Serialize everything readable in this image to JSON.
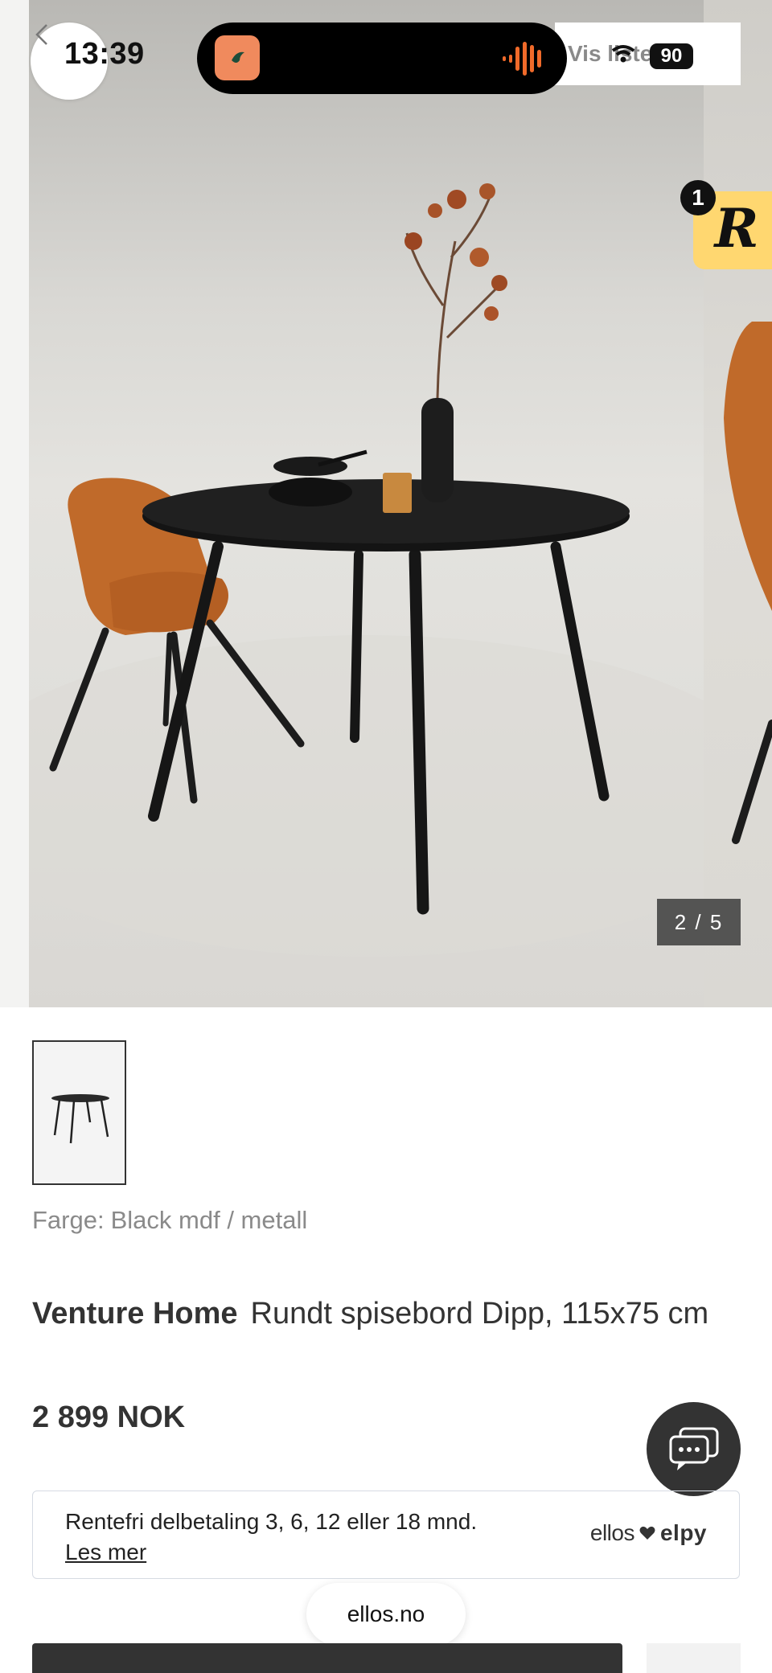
{
  "status_bar": {
    "time": "13:39",
    "battery": "90"
  },
  "gallery": {
    "counter": "2 / 5",
    "vis_liste_label": "Vis liste",
    "badge_letter": "R",
    "badge_count": "1"
  },
  "product": {
    "color_label": "Farge:",
    "color_value": "Black mdf / metall",
    "brand": "Venture Home",
    "name": "Rundt spisebord Dipp, 115x75 cm",
    "price": "2 899 NOK"
  },
  "installment": {
    "text": "Rentefri delbetaling 3, 6, 12 eller 18 mnd.",
    "link": "Les mer",
    "brand_left": "ellos",
    "brand_right": "elpy"
  },
  "browser": {
    "url": "ellos.no"
  },
  "colors": {
    "accent_badge": "#ffd770",
    "dark": "#333333",
    "island_app": "#f08a5d"
  }
}
